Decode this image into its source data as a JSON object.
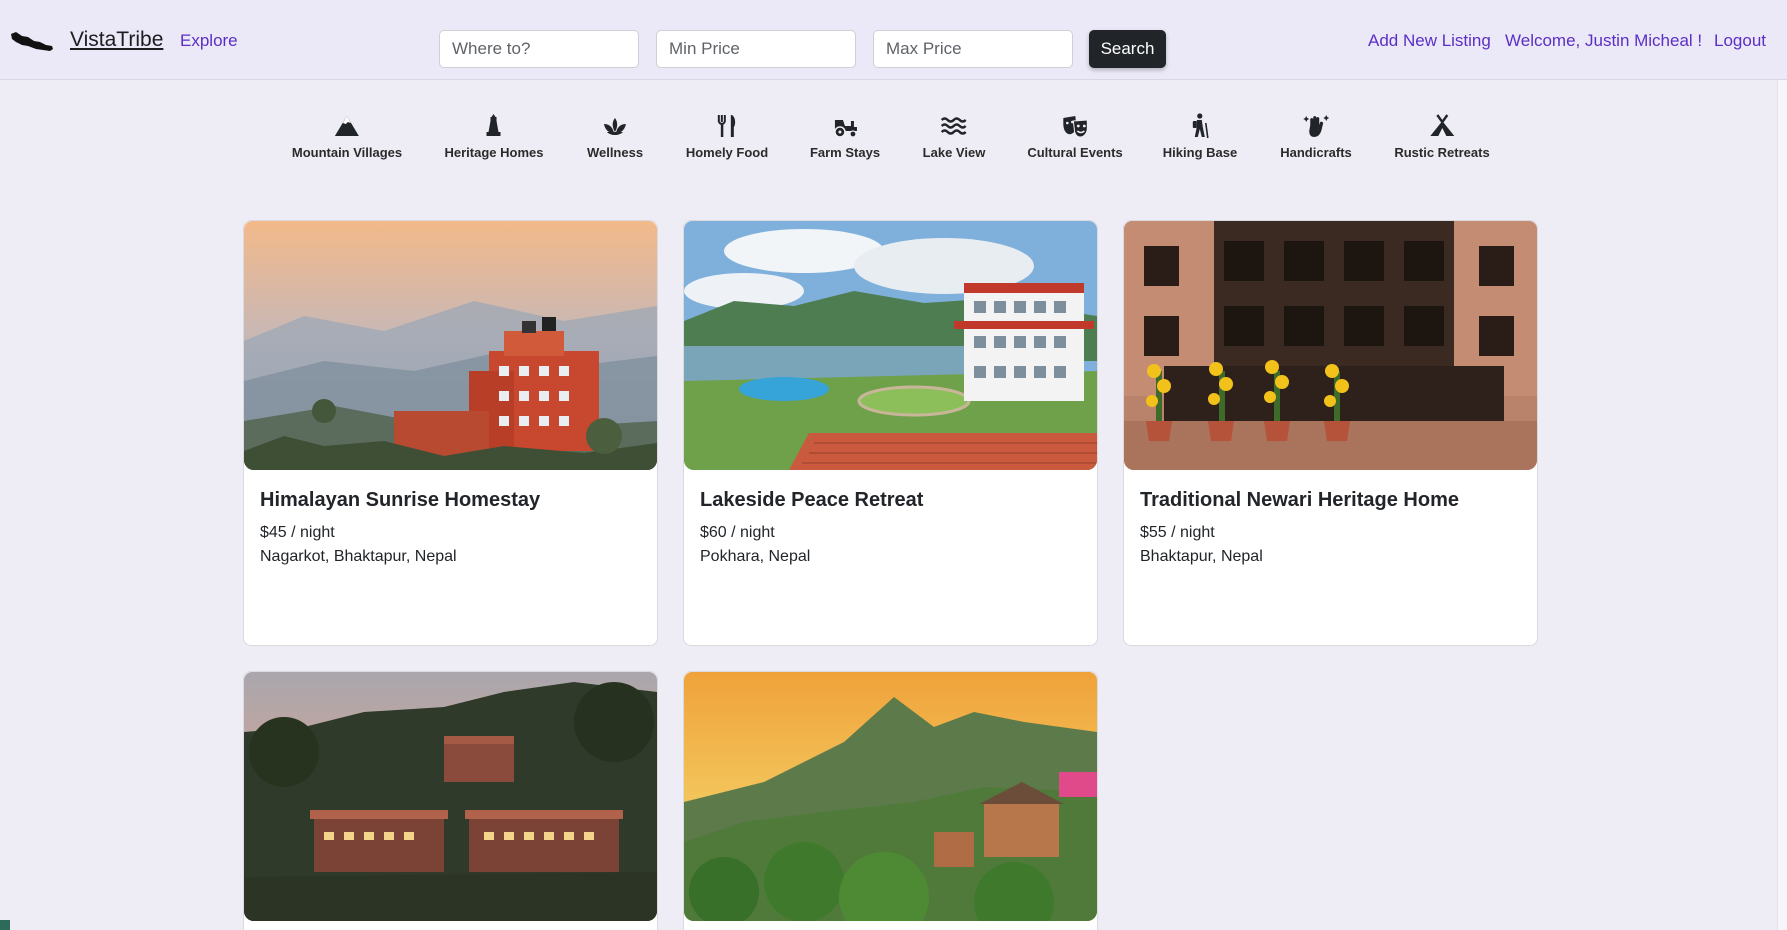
{
  "navbar": {
    "logo_icon": "nepal-map-icon",
    "brand": "VistaTribe",
    "explore": "Explore",
    "search": {
      "where_placeholder": "Where to?",
      "min_price_placeholder": "Min Price",
      "max_price_placeholder": "Max Price",
      "button_label": "Search"
    },
    "add_listing": "Add New Listing",
    "welcome": "Welcome, Justin Micheal !",
    "logout": "Logout"
  },
  "colors": {
    "accent": "#5b2fc4",
    "button": "#212529",
    "background": "#eeecf5"
  },
  "categories": [
    {
      "label": "Mountain Villages",
      "icon": "mountain-icon"
    },
    {
      "label": "Heritage Homes",
      "icon": "bell-monument-icon"
    },
    {
      "label": "Wellness",
      "icon": "lotus-icon"
    },
    {
      "label": "Homely Food",
      "icon": "utensils-icon"
    },
    {
      "label": "Farm Stays",
      "icon": "tractor-icon"
    },
    {
      "label": "Lake View",
      "icon": "water-waves-icon"
    },
    {
      "label": "Cultural Events",
      "icon": "masks-icon"
    },
    {
      "label": "Hiking Base",
      "icon": "hiker-icon"
    },
    {
      "label": "Handicrafts",
      "icon": "hand-sparkles-icon"
    },
    {
      "label": "Rustic Retreats",
      "icon": "campground-icon"
    }
  ],
  "listings": [
    {
      "title": "Himalayan Sunrise Homestay",
      "price": "$45 / night",
      "location": "Nagarkot, Bhaktapur, Nepal"
    },
    {
      "title": "Lakeside Peace Retreat",
      "price": "$60 / night",
      "location": "Pokhara, Nepal"
    },
    {
      "title": "Traditional Newari Heritage Home",
      "price": "$55 / night",
      "location": "Bhaktapur, Nepal"
    },
    {
      "title": "",
      "price": "",
      "location": ""
    },
    {
      "title": "",
      "price": "",
      "location": ""
    }
  ]
}
